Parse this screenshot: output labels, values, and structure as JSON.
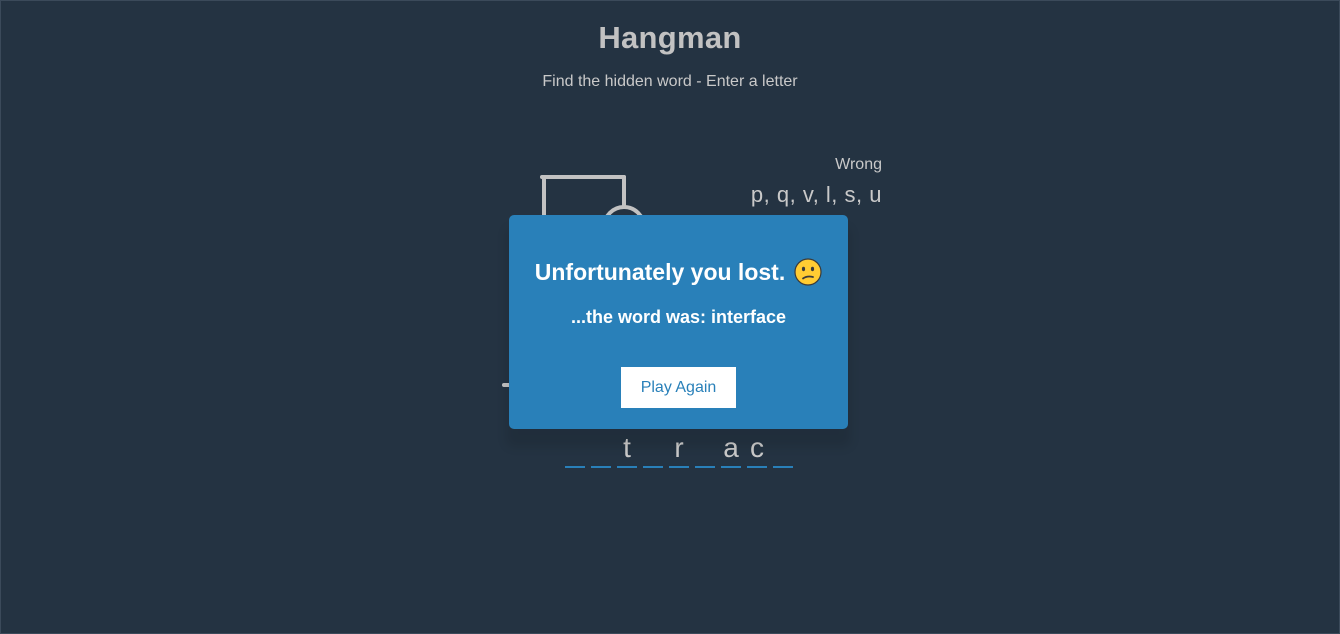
{
  "header": {
    "title": "Hangman",
    "subtitle": "Find the hidden word - Enter a letter"
  },
  "wrong_letters": {
    "title": "Wrong",
    "letters": [
      "p",
      "q",
      "v",
      "l",
      "s",
      "u"
    ],
    "display": "p, q, v, l, s, u"
  },
  "word": {
    "letters": [
      "",
      "",
      "t",
      "",
      "r",
      "",
      "a",
      "c",
      ""
    ]
  },
  "hangman": {
    "parts_shown": 6
  },
  "popup": {
    "message": "Unfortunately you lost.",
    "emoji_icon": "confused-face-icon",
    "reveal_text": "...the word was: interface",
    "button_label": "Play Again"
  },
  "colors": {
    "background": "#243342",
    "accent": "#2980b9",
    "figure": "#c2c2c2"
  }
}
